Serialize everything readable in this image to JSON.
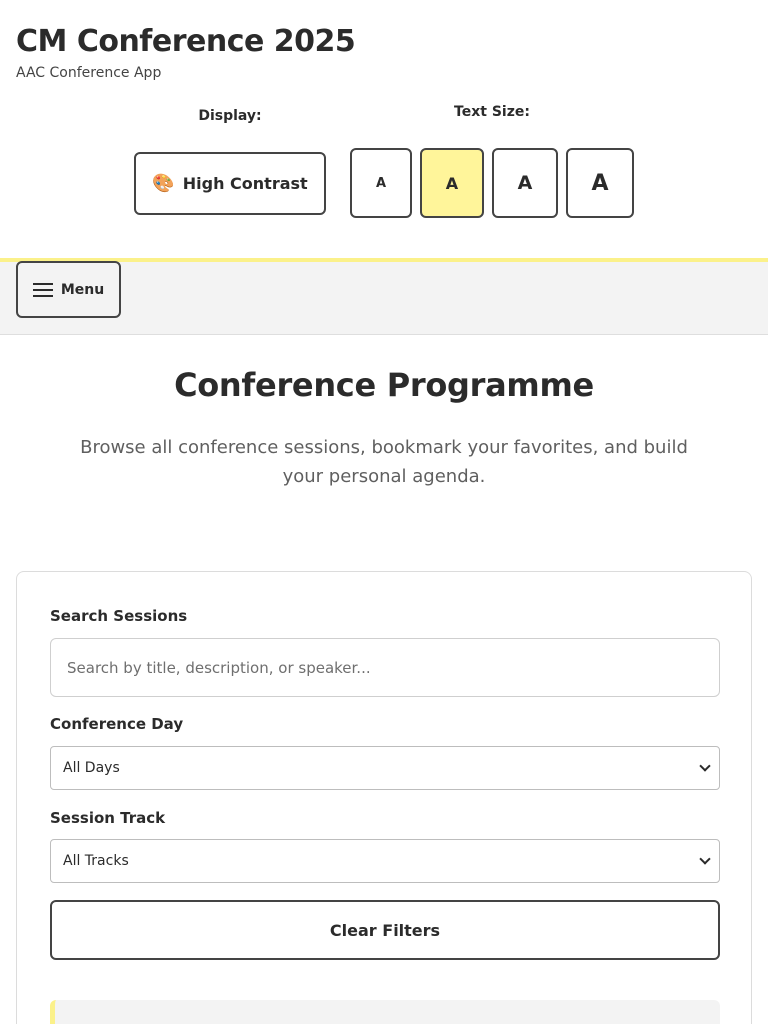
{
  "header": {
    "title": "CM Conference 2025",
    "subtitle": "AAC Conference App",
    "display_label": "Display:",
    "contrast_button": {
      "icon": "palette-icon",
      "label": "High Contrast"
    },
    "text_size_label": "Text Size:",
    "text_size_options": [
      {
        "label": "A",
        "active": false
      },
      {
        "label": "A",
        "active": true
      },
      {
        "label": "A",
        "active": false
      },
      {
        "label": "A",
        "active": false
      }
    ],
    "accent_color": "#fbf18a"
  },
  "nav": {
    "menu_button": {
      "icon": "hamburger-icon",
      "label": "Menu"
    }
  },
  "main": {
    "title": "Conference Programme",
    "intro": "Browse all conference sessions, bookmark your favorites, and build your personal agenda."
  },
  "filters": {
    "search": {
      "label": "Search Sessions",
      "placeholder": "Search by title, description, or speaker...",
      "value": ""
    },
    "day": {
      "label": "Conference Day",
      "selected": "All Days"
    },
    "track": {
      "label": "Session Track",
      "selected": "All Tracks"
    },
    "clear_label": "Clear Filters"
  }
}
